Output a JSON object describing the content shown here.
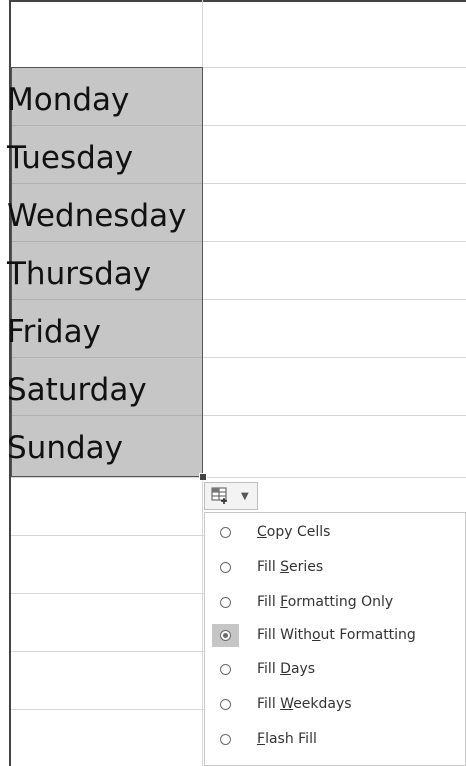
{
  "days": [
    "Monday",
    "Tuesday",
    "Wednesday",
    "Thursday",
    "Friday",
    "Saturday",
    "Sunday"
  ],
  "autofill_options": {
    "button_icon": "autofill-options-icon",
    "caret_icon": "chevron-down-icon",
    "items": [
      {
        "label_pre": "",
        "hotkey": "C",
        "label_post": "opy Cells",
        "selected": false
      },
      {
        "label_pre": "Fill ",
        "hotkey": "S",
        "label_post": "eries",
        "selected": false
      },
      {
        "label_pre": "Fill ",
        "hotkey": "F",
        "label_post": "ormatting Only",
        "selected": false
      },
      {
        "label_pre": "Fill With",
        "hotkey": "o",
        "label_post": "ut Formatting",
        "selected": true
      },
      {
        "label_pre": "Fill ",
        "hotkey": "D",
        "label_post": "ays",
        "selected": false
      },
      {
        "label_pre": "Fill ",
        "hotkey": "W",
        "label_post": "eekdays",
        "selected": false
      },
      {
        "label_pre": "",
        "hotkey": "F",
        "label_post": "lash Fill",
        "selected": false
      }
    ]
  },
  "colors": {
    "selection_fill": "#c6c6c6",
    "grid": "#d6d6d6",
    "border": "#444444"
  }
}
